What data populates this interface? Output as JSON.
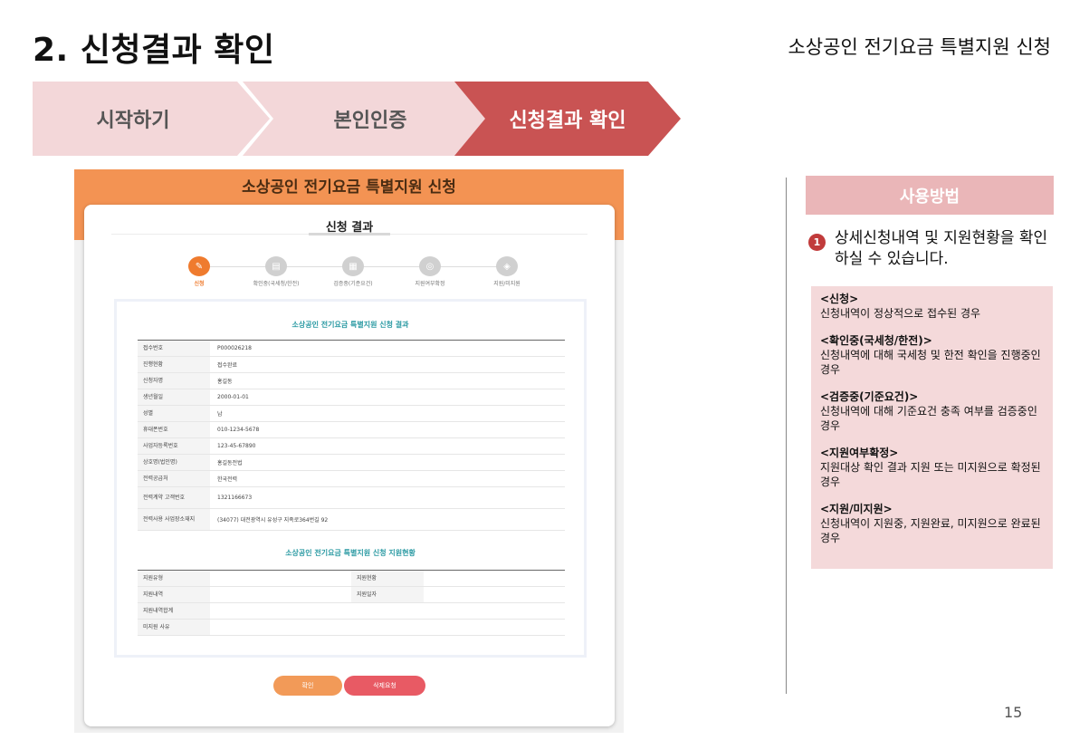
{
  "slide": {
    "title": "2. 신청결과 확인",
    "subtitle": "소상공인 전기요금 특별지원 신청",
    "page_number": "15"
  },
  "steps": [
    {
      "label": "시작하기"
    },
    {
      "label": "본인인증"
    },
    {
      "label": "신청결과 확인"
    }
  ],
  "screen": {
    "header_title": "소상공인 전기요금 특별지원 신청",
    "card_title": "신청 결과",
    "progress": [
      {
        "label": "신청",
        "icon": "doc-icon",
        "glyph": "✎"
      },
      {
        "label": "확인중(국세청/한전)",
        "icon": "doc-icon",
        "glyph": "▤"
      },
      {
        "label": "검증중(기준요건)",
        "icon": "doc-icon",
        "glyph": "▦"
      },
      {
        "label": "지원여부확정",
        "icon": "money-icon",
        "glyph": "◎"
      },
      {
        "label": "지원/미지원",
        "icon": "money-icon",
        "glyph": "◈"
      }
    ],
    "result_title": "소상공인 전기요금 특별지원 신청 결과",
    "result_rows": [
      {
        "label": "접수번호",
        "value": "P000026218"
      },
      {
        "label": "진행현황",
        "value": "접수완료"
      },
      {
        "label": "신청자명",
        "value": "홍길동"
      },
      {
        "label": "생년월일",
        "value": "2000-01-01"
      },
      {
        "label": "성별",
        "value": "남"
      },
      {
        "label": "휴대폰번호",
        "value": "010-1234-5678"
      },
      {
        "label": "사업자등록번호",
        "value": "123-45-67890"
      },
      {
        "label": "상호명(법인명)",
        "value": "홍길동전법"
      },
      {
        "label": "전력공급처",
        "value": "한국전력"
      },
      {
        "label": "전력계약 고객번호",
        "value": "1321166673"
      },
      {
        "label": "전력사용 사업장소재지",
        "value": "(34077) 대전광역시 유성구 지족로364번길 92"
      }
    ],
    "support_title": "소상공인 전기요금 특별지원 신청 지원현황",
    "support_rows": [
      {
        "label1": "지원유형",
        "value1": "",
        "label2": "지원현황",
        "value2": ""
      },
      {
        "label1": "지원내역",
        "value1": "",
        "label2": "지원일자",
        "value2": ""
      }
    ],
    "support_rows_full": [
      {
        "label": "지원내역합계",
        "value": ""
      },
      {
        "label": "미지원 사유",
        "value": ""
      }
    ],
    "buttons": {
      "confirm": "확인",
      "delete": "삭제요청"
    }
  },
  "usage": {
    "header": "사용방법",
    "step_number": "1",
    "step_text": "상세신청내역 및 지원현황을 확인하실 수 있습니다.",
    "legend": [
      {
        "head": "<신청>",
        "desc": "신청내역이 정상적으로 접수된 경우"
      },
      {
        "head": "<확인중(국세청/한전)>",
        "desc": "신청내역에 대해 국세청 및 한전 확인을 진행중인 경우"
      },
      {
        "head": "<검증중(기준요건)>",
        "desc": "신청내역에 대해 기준요건 충족 여부를 검증중인 경우"
      },
      {
        "head": "<지원여부확정>",
        "desc": "지원대상 확인 결과 지원 또는 미지원으로 확정된 경우"
      },
      {
        "head": "<지원/미지원>",
        "desc": "신청내역이 지원중, 지원완료, 미지원으로 완료된 경우"
      }
    ]
  },
  "colors": {
    "active_step": "#c95353",
    "inactive_step": "#f3d7d9",
    "orange_header": "#f39353",
    "teal_title": "#2b9aa3",
    "badge": "#c13b3b"
  }
}
